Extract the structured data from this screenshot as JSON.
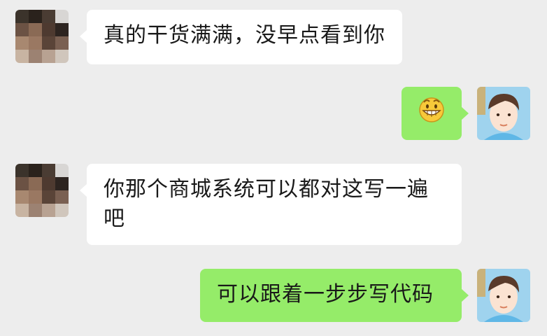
{
  "colors": {
    "background": "#ededed",
    "incoming_bubble": "#ffffff",
    "outgoing_bubble": "#95ec69",
    "text": "#191919"
  },
  "messages": [
    {
      "direction": "incoming",
      "text": "真的干货满满，没早点看到你"
    },
    {
      "direction": "outgoing",
      "emoji": "grinning-face-emoji"
    },
    {
      "direction": "incoming",
      "text": "你那个商城系统可以都对这写一遍吧"
    },
    {
      "direction": "outgoing",
      "text": "可以跟着一步步写代码"
    }
  ]
}
